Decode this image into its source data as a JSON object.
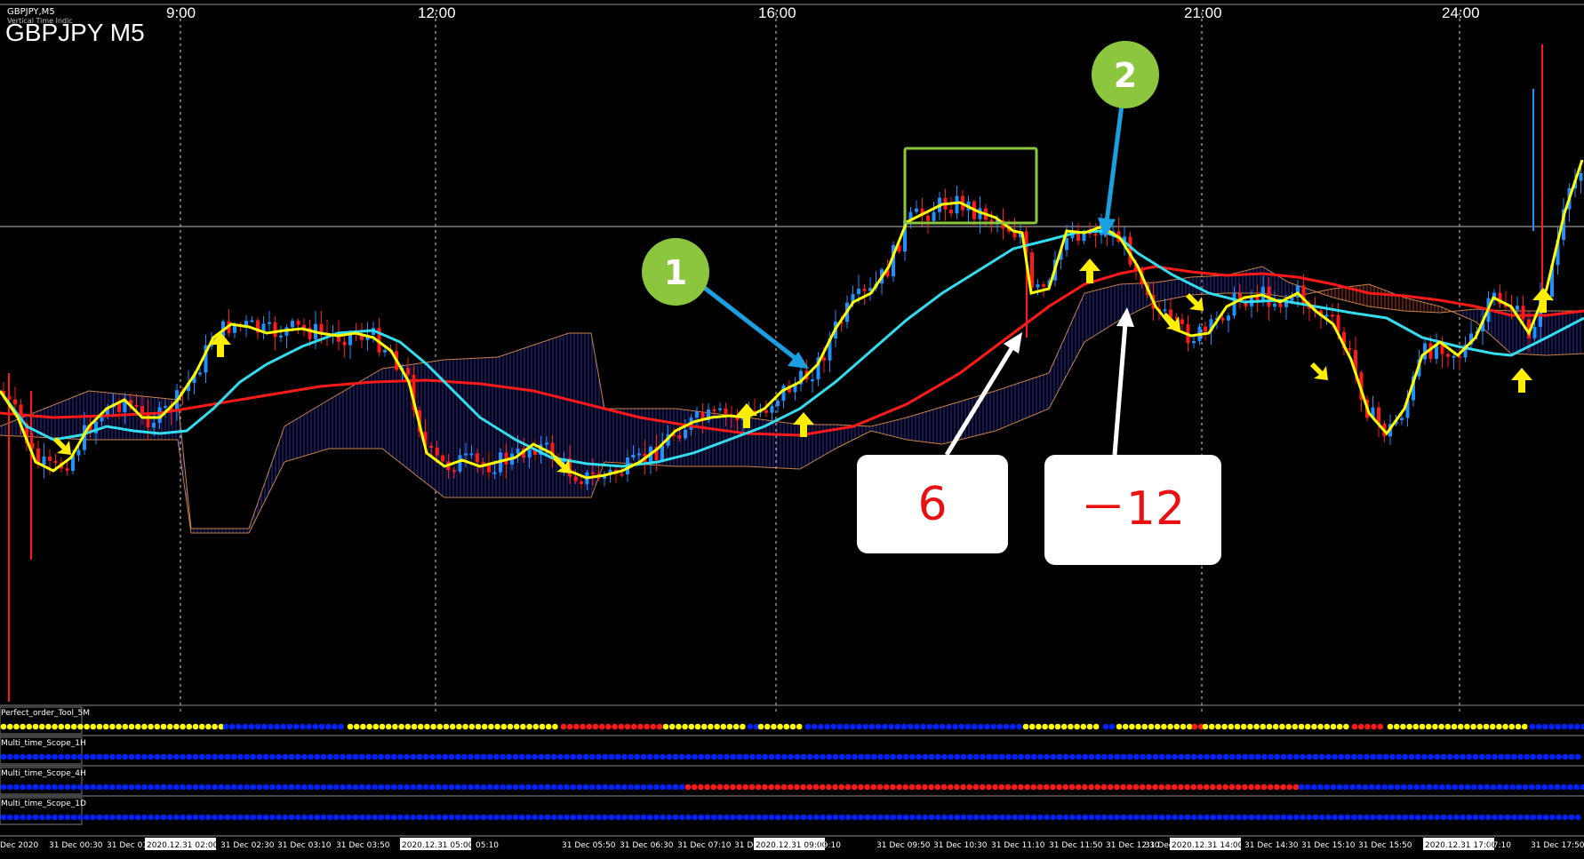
{
  "window": {
    "caption_small": "GBPJPY,M5",
    "caption_small2": "Vertical Time Indic",
    "symbol_title": "GBPJPY M5"
  },
  "top_time_labels": [
    "9:00",
    "12:00",
    "16:00",
    "21:00",
    "24:00"
  ],
  "callouts": {
    "one": "1",
    "two": "2",
    "six": "6",
    "minus_twelve": "－12"
  },
  "indicator_rows": [
    {
      "label": "Perfect_order_Tool_5M"
    },
    {
      "label": "Multi_time_Scope_1H"
    },
    {
      "label": "Multi_time_Scope_4H"
    },
    {
      "label": "Multi_time_Scope_1D"
    }
  ],
  "bottom_time_labels": [
    "Dec 2020",
    "31 Dec 00:30",
    "31 Dec 01",
    "2020.12.31 02:00",
    "31 Dec 02:30",
    "31 Dec 03:10",
    "31 Dec 03:50",
    "2020.12.31 05:00",
    "05:10",
    "31 Dec 05:50",
    "31 Dec 06:30",
    "31 Dec 07:10",
    "31 Dec 07:50",
    "2020.12.31 09:00",
    "09:10",
    "31 Dec 09:50",
    "31 Dec 10:30",
    "31 Dec 11:10",
    "31 Dec 11:50",
    "31 Dec 12:30",
    "31 Dec 1",
    "2020.12.31 14:00",
    "31 Dec 14:30",
    "31 Dec 15:10",
    "31 Dec 15:50",
    "2020.12.31 17:00",
    "17:10",
    "31 Dec 17:50"
  ],
  "colors": {
    "background": "#000000",
    "bull_candle": "#1e90ff",
    "bear_candle": "#ff1a1a",
    "ma_fast": "#ffff00",
    "ma_mid": "#33ddee",
    "ma_slow": "#ff1a1a",
    "callout_green": "#8cc63f",
    "arrow_blue": "#1aa0e0",
    "dot_yellow": "#ffff00",
    "dot_blue": "#0022ff",
    "dot_red": "#ff1a1a"
  }
}
